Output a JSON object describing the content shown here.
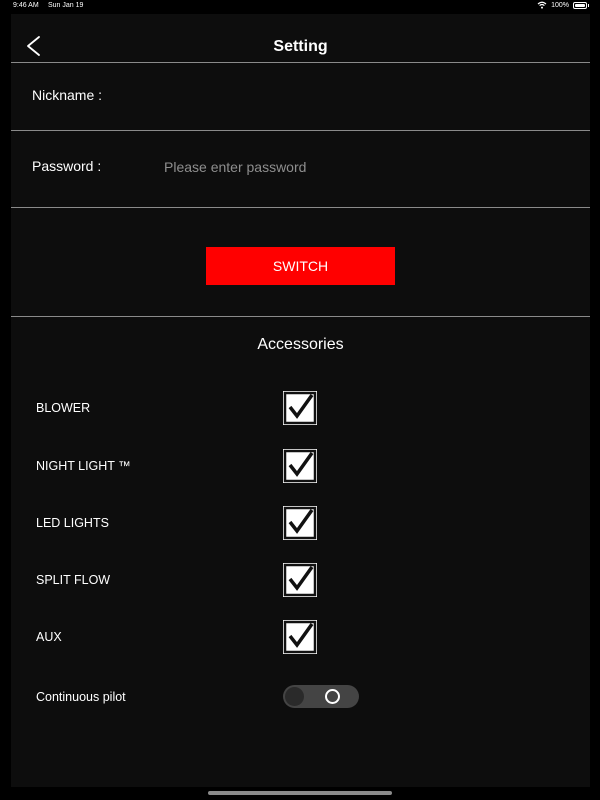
{
  "status_bar": {
    "time": "9:46 AM",
    "date": "Sun Jan 19",
    "battery": "100%",
    "icons": [
      "wifi-icon",
      "battery-icon"
    ]
  },
  "header": {
    "title": "Setting",
    "back_icon": "chevron-left-icon"
  },
  "form": {
    "nickname_label": "Nickname :",
    "nickname_value": "",
    "password_label": "Password :",
    "password_placeholder": "Please enter password",
    "password_value": ""
  },
  "switch_button": {
    "label": "SWITCH",
    "color": "#ff0000"
  },
  "accessories": {
    "title": "Accessories",
    "items": [
      {
        "label": "BLOWER",
        "checked": true
      },
      {
        "label": "NIGHT LIGHT ™",
        "checked": true
      },
      {
        "label": "LED LIGHTS",
        "checked": true
      },
      {
        "label": "SPLIT FLOW",
        "checked": true
      },
      {
        "label": "AUX",
        "checked": true
      }
    ],
    "continuous_pilot": {
      "label": "Continuous pilot",
      "on": false
    }
  },
  "colors": {
    "background": "#0d0d0d",
    "accent": "#ff0000",
    "divider": "#8a8a8a"
  }
}
